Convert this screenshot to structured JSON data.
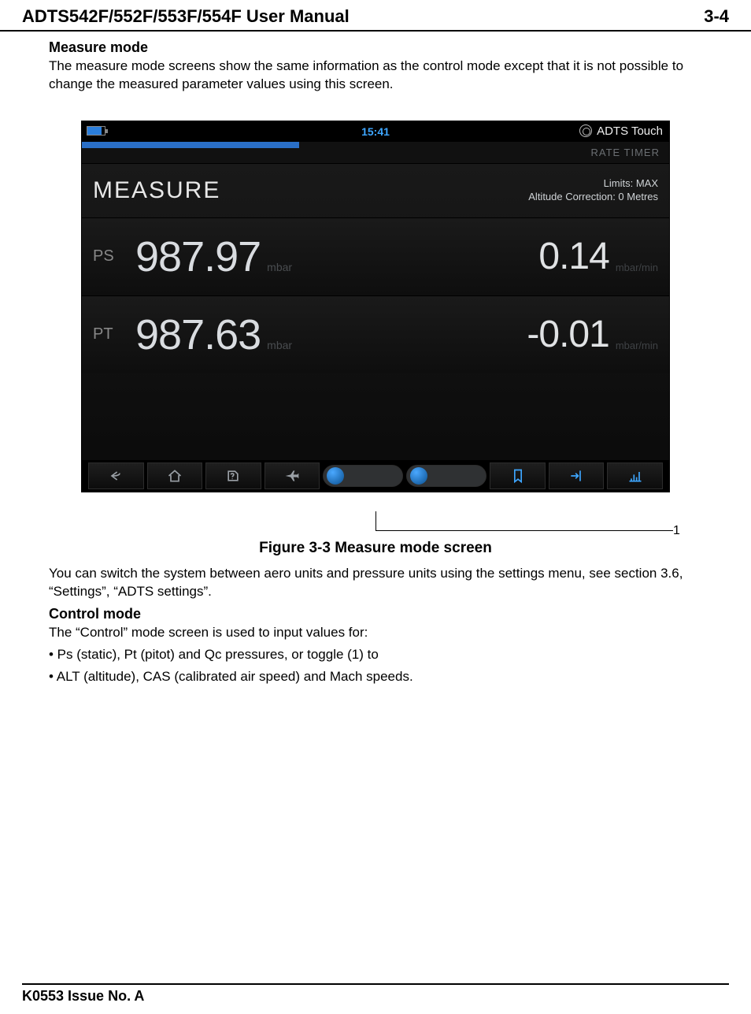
{
  "doc": {
    "title": "ADTS542F/552F/553F/554F User Manual",
    "page_number": "3-4",
    "footer": "K0553 Issue No. A"
  },
  "sections": {
    "measure_mode_title": "Measure mode",
    "measure_mode_text": "The measure mode screens show the same information as the control mode except that it is not possible to change the measured parameter values using this screen.",
    "figure_caption": "Figure 3-3 Measure mode screen",
    "after_fig_text": "You can switch the system between aero units and pressure units using the settings menu, see section 3.6, “Settings”, “ADTS settings”.",
    "control_mode_title": "Control mode",
    "control_mode_text": "The “Control” mode screen is used to input values for:",
    "bullet1": "• Ps (static), Pt (pitot) and Qc pressures, or toggle (1) to",
    "bullet2": "• ALT (altitude), CAS (calibrated air speed) and Mach speeds.",
    "callout_1": "1"
  },
  "screen": {
    "status_time": "15:41",
    "brand": "ADTS Touch",
    "rate_timer": "RATE TIMER",
    "mode_label": "MEASURE",
    "limits_line": "Limits: MAX",
    "alt_corr_line": "Altitude Correction: 0 Metres",
    "channels": [
      {
        "label": "PS",
        "value": "987.97",
        "unit": "mbar",
        "rate": "0.14",
        "rate_unit": "mbar/min"
      },
      {
        "label": "PT",
        "value": "987.63",
        "unit": "mbar",
        "rate": "-0.01",
        "rate_unit": "mbar/min"
      }
    ],
    "bottombar_icons": [
      "back-icon",
      "home-icon",
      "help-icon",
      "aircraft-icon",
      "gauge-toggle-icon",
      "units-toggle-icon",
      "hold-icon",
      "vent-icon",
      "graph-icon"
    ]
  }
}
